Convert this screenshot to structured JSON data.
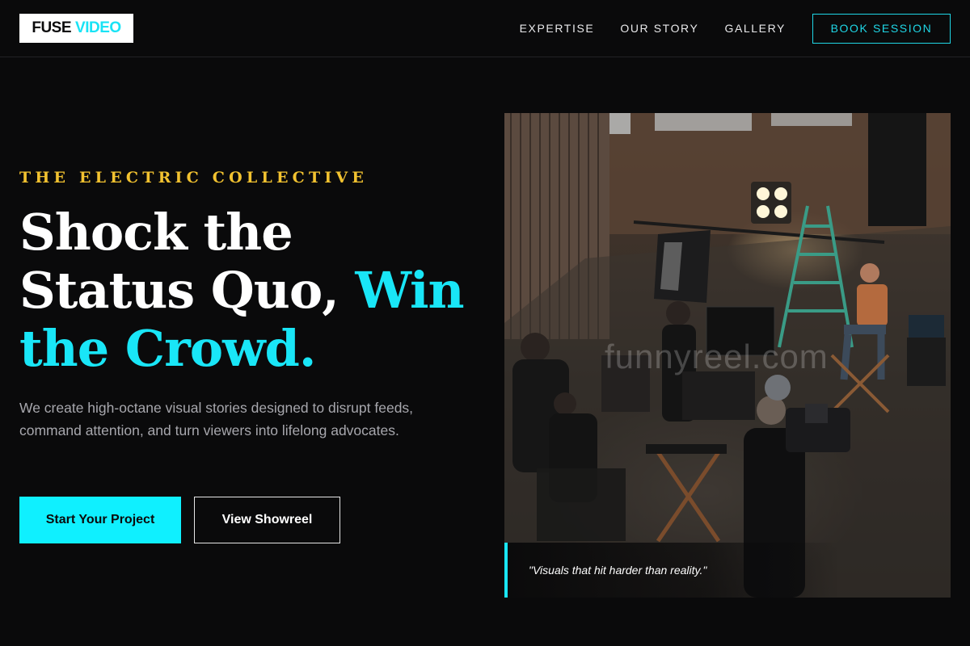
{
  "brand": {
    "logo_part1": "FUSE",
    "logo_part2": "VIDEO"
  },
  "nav": {
    "items": [
      {
        "label": "EXPERTISE"
      },
      {
        "label": "OUR STORY"
      },
      {
        "label": "GALLERY"
      }
    ],
    "cta_label": "BOOK SESSION"
  },
  "hero": {
    "eyebrow": "THE ELECTRIC COLLECTIVE",
    "headline_white": "Shock the Status Quo, ",
    "headline_accent": "Win the Crowd.",
    "description": "We create high-octane visual stories designed to disrupt feeds, command attention, and turn viewers into lifelong advocates.",
    "primary_button": "Start Your Project",
    "secondary_button": "View Showreel",
    "image_watermark": "funnyreel.com",
    "quote": "\"Visuals that hit harder than reality.\""
  },
  "colors": {
    "accent_cyan": "#19e6f7",
    "eyebrow_gold": "#f2c230",
    "background": "#0a0a0b"
  },
  "icons": []
}
